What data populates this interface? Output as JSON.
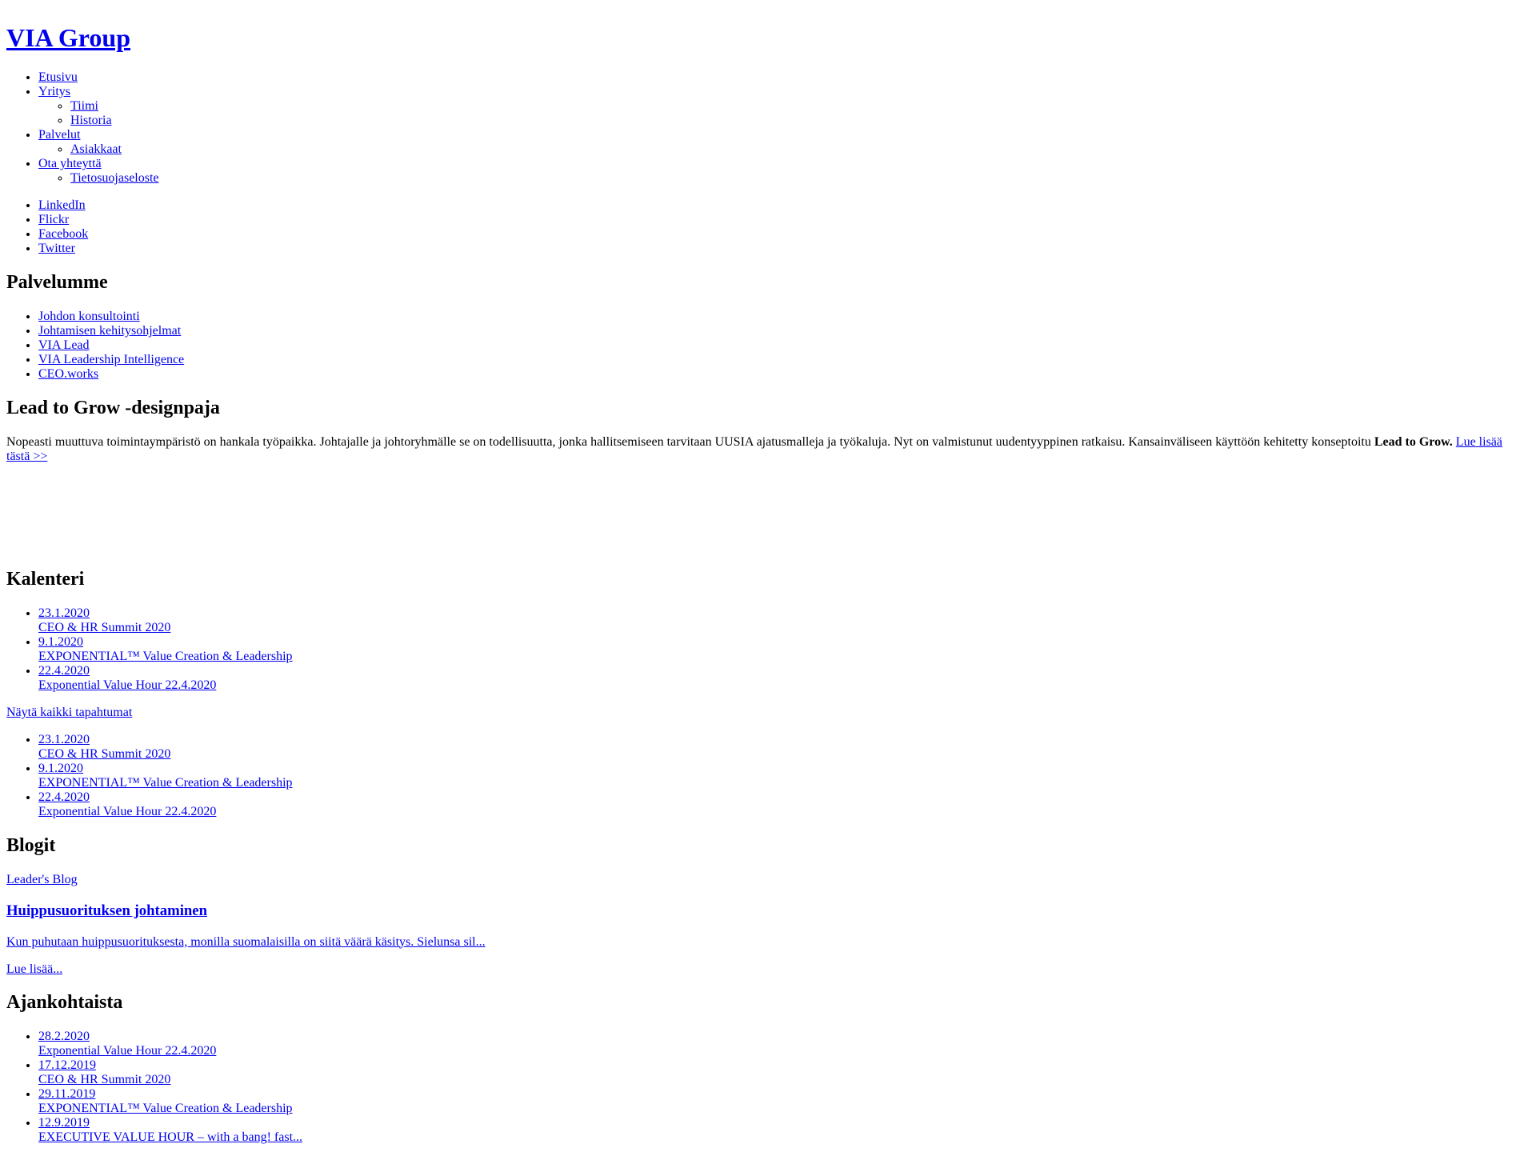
{
  "site": {
    "title": "VIA Group"
  },
  "main_nav": [
    {
      "label": "Etusivu",
      "children": []
    },
    {
      "label": "Yritys",
      "children": [
        {
          "label": "Tiimi"
        },
        {
          "label": "Historia"
        }
      ]
    },
    {
      "label": "Palvelut",
      "children": [
        {
          "label": "Asiakkaat"
        }
      ]
    },
    {
      "label": "Ota yhteyttä",
      "children": [
        {
          "label": "Tietosuojaseloste"
        }
      ]
    }
  ],
  "social_nav": [
    {
      "label": "LinkedIn"
    },
    {
      "label": "Flickr"
    },
    {
      "label": "Facebook"
    },
    {
      "label": "Twitter"
    }
  ],
  "services": {
    "heading": "Palvelumme",
    "items": [
      {
        "label": "Johdon konsultointi"
      },
      {
        "label": "Johtamisen kehitysohjelmat"
      },
      {
        "label": "VIA Lead"
      },
      {
        "label": "VIA Leadership Intelligence"
      },
      {
        "label": "CEO.works"
      }
    ]
  },
  "feature": {
    "heading": "Lead to Grow -designpaja",
    "body_part1": "Nopeasti muuttuva toimintaympäristö on hankala työpaikka. Johtajalle ja johtoryhmälle se on todellisuutta, jonka hallitsemiseen tarvitaan UUSIA ajatusmalleja ja työkaluja. Nyt on valmistunut uudentyyppinen ratkaisu. Kansainväliseen käyttöön kehitetty konseptoitu ",
    "body_bold": "Lead to Grow.",
    "body_link": "Lue lisää tästä >>"
  },
  "calendar": {
    "heading": "Kalenteri",
    "events": [
      {
        "date": "23.1.2020",
        "title": "CEO & HR Summit 2020"
      },
      {
        "date": "9.1.2020",
        "title": "EXPONENTIAL™ Value Creation & Leadership"
      },
      {
        "date": "22.4.2020",
        "title": "Exponential Value Hour 22.4.2020"
      }
    ],
    "show_all_label": "Näytä kaikki tapahtumat",
    "events_secondary": [
      {
        "date": "23.1.2020",
        "title": "CEO & HR Summit 2020"
      },
      {
        "date": "9.1.2020",
        "title": "EXPONENTIAL™ Value Creation & Leadership"
      },
      {
        "date": "22.4.2020",
        "title": "Exponential Value Hour 22.4.2020"
      }
    ]
  },
  "blogs": {
    "heading": "Blogit",
    "blog_name": "Leader's Blog",
    "post_title": "Huippusuorituksen johtaminen",
    "post_excerpt": "Kun puhutaan huippusuorituksesta, monilla suomalaisilla on siitä väärä käsitys. Sielunsa sil...",
    "read_more_label": "Lue lisää..."
  },
  "news": {
    "heading": "Ajankohtaista",
    "items": [
      {
        "date": "28.2.2020",
        "title": "Exponential Value Hour 22.4.2020"
      },
      {
        "date": "17.12.2019",
        "title": "CEO & HR Summit 2020"
      },
      {
        "date": "29.11.2019",
        "title": "EXPONENTIAL™ Value Creation & Leadership"
      },
      {
        "date": "12.9.2019",
        "title": "EXECUTIVE VALUE HOUR – with a bang! fast..."
      }
    ]
  }
}
